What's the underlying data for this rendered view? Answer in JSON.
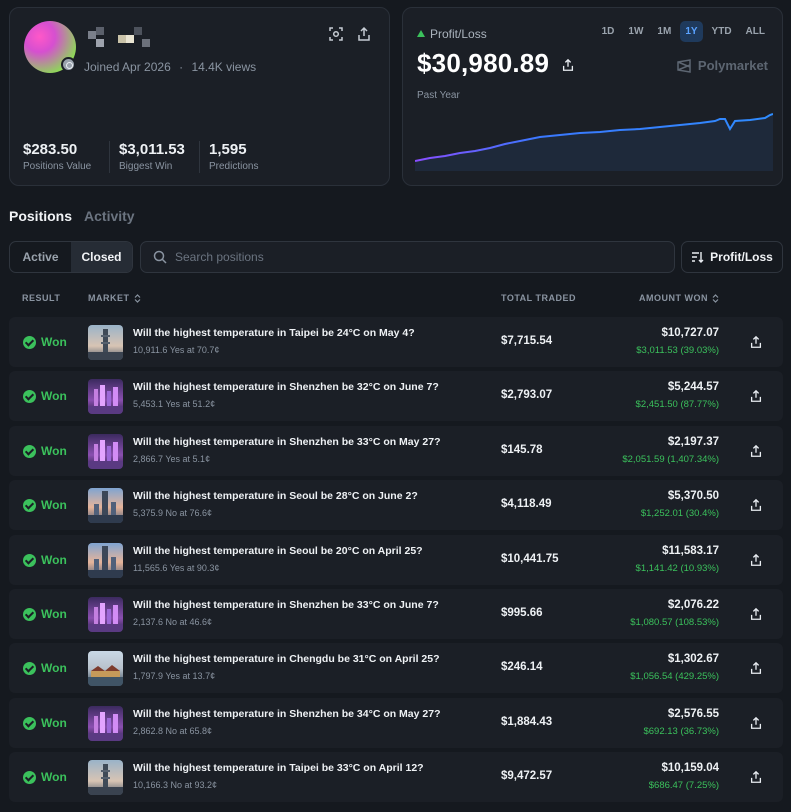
{
  "profile": {
    "joined": "Joined Apr 2026",
    "views": "14.4K views",
    "stats": [
      {
        "value": "$283.50",
        "label": "Positions Value"
      },
      {
        "value": "$3,011.53",
        "label": "Biggest Win"
      },
      {
        "value": "1,595",
        "label": "Predictions"
      }
    ]
  },
  "pnl": {
    "label": "Profit/Loss",
    "value": "$30,980.89",
    "period": "Past Year",
    "brand": "Polymarket",
    "ranges": [
      "1D",
      "1W",
      "1M",
      "1Y",
      "YTD",
      "ALL"
    ],
    "active_range": "1Y",
    "colors": {
      "line_start": "#8a4dff",
      "line_end": "#2f8cff",
      "area": "#1f2a3d"
    }
  },
  "tabs": {
    "positions": "Positions",
    "activity": "Activity"
  },
  "filters": {
    "active": "Active",
    "closed": "Closed",
    "search_placeholder": "Search positions",
    "sort": "Profit/Loss"
  },
  "table": {
    "headers": {
      "result": "RESULT",
      "market": "MARKET",
      "total_traded": "TOTAL TRADED",
      "amount_won": "AMOUNT WON"
    },
    "rows": [
      {
        "result": "Won",
        "market": "Will the highest temperature in Taipei be 24°C on May 4?",
        "shares": "10,911.6 Yes at 70.7¢",
        "traded": "$7,715.54",
        "amount": "$10,727.07",
        "gain": "$3,011.53 (39.03%)",
        "thumb": "taipei"
      },
      {
        "result": "Won",
        "market": "Will the highest temperature in Shenzhen be 32°C on June 7?",
        "shares": "5,453.1 Yes at 51.2¢",
        "traded": "$2,793.07",
        "amount": "$5,244.57",
        "gain": "$2,451.50 (87.77%)",
        "thumb": "shenzhen"
      },
      {
        "result": "Won",
        "market": "Will the highest temperature in Shenzhen be 33°C on May 27?",
        "shares": "2,866.7 Yes at 5.1¢",
        "traded": "$145.78",
        "amount": "$2,197.37",
        "gain": "$2,051.59 (1,407.34%)",
        "thumb": "shenzhen"
      },
      {
        "result": "Won",
        "market": "Will the highest temperature in Seoul be 28°C on June 2?",
        "shares": "5,375.9 No at 76.6¢",
        "traded": "$4,118.49",
        "amount": "$5,370.50",
        "gain": "$1,252.01 (30.4%)",
        "thumb": "seoul"
      },
      {
        "result": "Won",
        "market": "Will the highest temperature in Seoul be 20°C on April 25?",
        "shares": "11,565.6 Yes at 90.3¢",
        "traded": "$10,441.75",
        "amount": "$11,583.17",
        "gain": "$1,141.42 (10.93%)",
        "thumb": "seoul"
      },
      {
        "result": "Won",
        "market": "Will the highest temperature in Shenzhen be 33°C on June 7?",
        "shares": "2,137.6 No at 46.6¢",
        "traded": "$995.66",
        "amount": "$2,076.22",
        "gain": "$1,080.57 (108.53%)",
        "thumb": "shenzhen"
      },
      {
        "result": "Won",
        "market": "Will the highest temperature in Chengdu be 31°C on April 25?",
        "shares": "1,797.9 Yes at 13.7¢",
        "traded": "$246.14",
        "amount": "$1,302.67",
        "gain": "$1,056.54 (429.25%)",
        "thumb": "chengdu"
      },
      {
        "result": "Won",
        "market": "Will the highest temperature in Shenzhen be 34°C on May 27?",
        "shares": "2,862.8 No at 65.8¢",
        "traded": "$1,884.43",
        "amount": "$2,576.55",
        "gain": "$692.13 (36.73%)",
        "thumb": "shenzhen"
      },
      {
        "result": "Won",
        "market": "Will the highest temperature in Taipei be 33°C on April 12?",
        "shares": "10,166.3 No at 93.2¢",
        "traded": "$9,472.57",
        "amount": "$10,159.04",
        "gain": "$686.47 (7.25%)",
        "thumb": "taipei"
      }
    ]
  }
}
